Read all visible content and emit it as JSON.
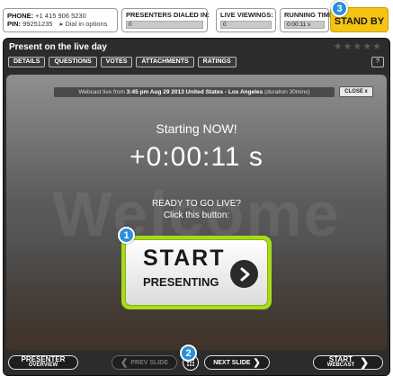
{
  "topbar": {
    "phone_label": "PHONE:",
    "phone_value": "+1 415 906 5230",
    "pin_label": "PIN:",
    "pin_value": "99251235",
    "dial_options": "▸ Dial in options",
    "presenters_label": "PRESENTERS DIALED IN:",
    "presenters_value": "0",
    "viewings_label": "LIVE VIEWINGS:",
    "viewings_value": "0",
    "runtime_label": "RUNNING TIME:",
    "runtime_value": "0:00:11 s",
    "standby_label": "STAND BY"
  },
  "badges": {
    "one": "1",
    "two": "2",
    "three": "3"
  },
  "panel": {
    "title": "Present on the live day",
    "rating_stars": "★★★★★",
    "tabs": [
      "DETAILS",
      "QUESTIONS",
      "VOTES",
      "ATTACHMENTS",
      "RATINGS"
    ],
    "help": "?"
  },
  "stage": {
    "info_prefix": "Webcast live from ",
    "info_bold": "3:45 pm Aug 29 2013 United States - Los Angeles",
    "info_suffix": " (duration 30mins)",
    "close_label": "CLOSE x",
    "watermark": "Welcome",
    "starting": "Starting NOW!",
    "timer": "+0:00:11 s",
    "ready_line1": "READY TO GO LIVE?",
    "ready_line2": "Click this button:",
    "start_line1": "START",
    "start_line2": "PRESENTING"
  },
  "nav": {
    "presenter_overview_1": "PRESENTER",
    "presenter_overview_2": "OVERVIEW",
    "prev_slide": "PREV SLIDE",
    "next_slide": "NEXT SLIDE",
    "start_webcast_1": "START",
    "start_webcast_2": "WEBCAST"
  },
  "colors": {
    "accent_green": "#a6dc18",
    "standby_yellow": "#f5c413",
    "badge_blue": "#2a8fd6"
  }
}
